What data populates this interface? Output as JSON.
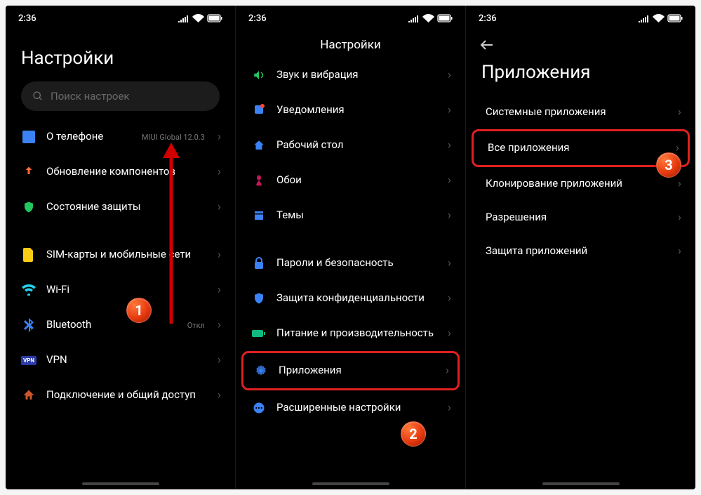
{
  "status": {
    "time": "2:36"
  },
  "badges": {
    "one": "1",
    "two": "2",
    "three": "3"
  },
  "screen1": {
    "title": "Настройки",
    "search_placeholder": "Поиск настроек",
    "about": "О телефоне",
    "about_sub": "MIUI Global 12.0.3",
    "updates": "Обновление компонентов",
    "security": "Состояние защиты",
    "sim": "SIM-карты и мобильные сети",
    "wifi": "Wi-Fi",
    "bluetooth": "Bluetooth",
    "bluetooth_sub": "Откл",
    "vpn": "VPN",
    "share": "Подключение и общий доступ"
  },
  "screen2": {
    "title": "Настройки",
    "sound": "Звук и вибрация",
    "notif": "Уведомления",
    "home": "Рабочий стол",
    "wallpaper": "Обои",
    "themes": "Темы",
    "passwords": "Пароли и безопасность",
    "privacy": "Защита конфиденциальности",
    "battery": "Питание и производительность",
    "apps": "Приложения",
    "advanced": "Расширенные настройки"
  },
  "screen3": {
    "title": "Приложения",
    "system_apps": "Системные приложения",
    "all_apps": "Все приложения",
    "clone": "Клонирование приложений",
    "permissions": "Разрешения",
    "lock": "Защита приложений"
  }
}
